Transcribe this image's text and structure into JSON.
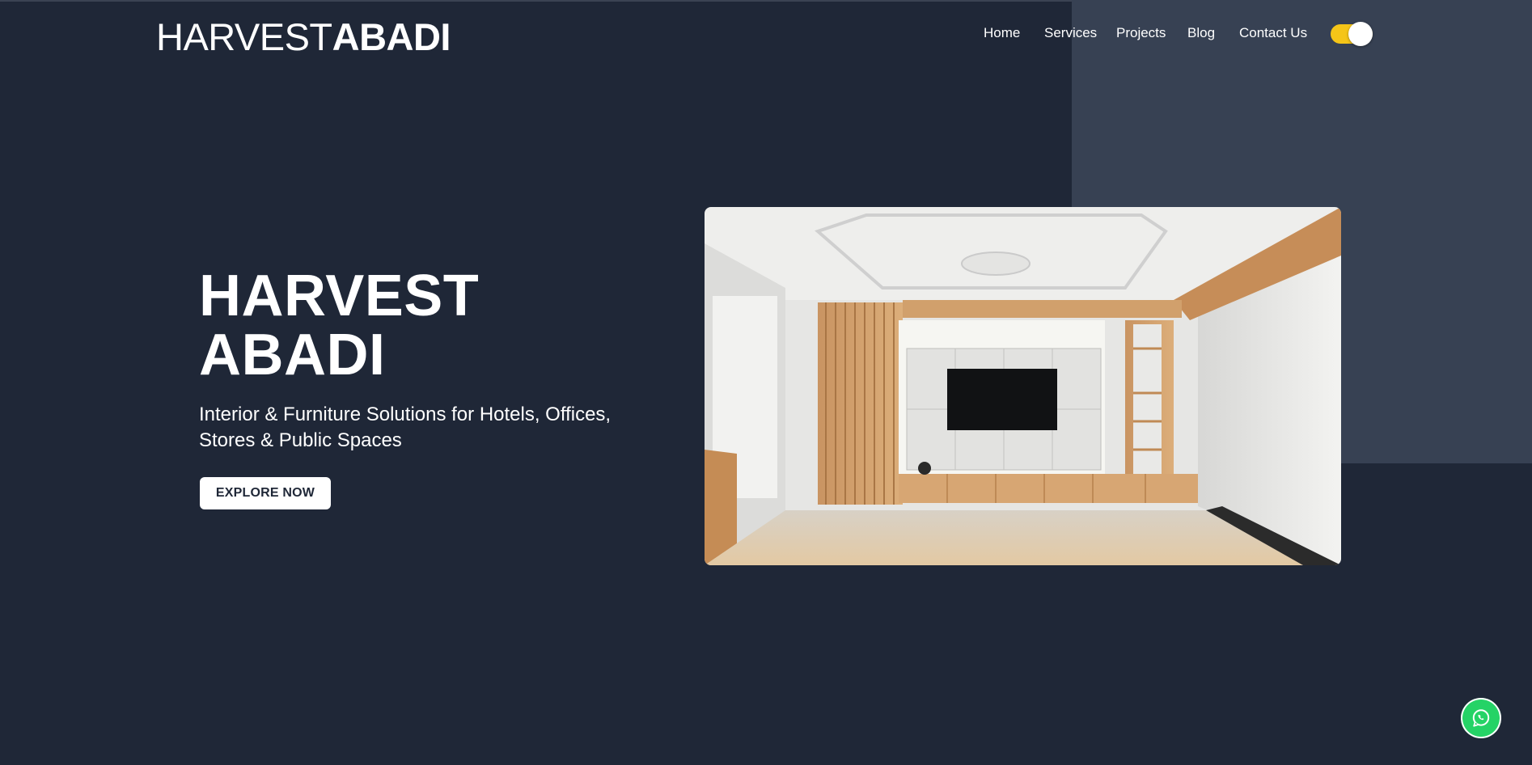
{
  "brand": {
    "name_light": "HARVEST",
    "name_bold": "ABADI"
  },
  "nav": {
    "items": [
      {
        "label": "Home"
      },
      {
        "label": "Services"
      },
      {
        "label": "Projects"
      },
      {
        "label": "Blog"
      },
      {
        "label": "Contact Us"
      }
    ]
  },
  "theme_toggle": {
    "state": "on",
    "color": "#f5c518"
  },
  "hero": {
    "title_line1": "HARVEST",
    "title_line2": "ABADI",
    "subtitle": "Interior & Furniture Solutions for Hotels, Offices, Stores & Public Spaces",
    "cta_label": "EXPLORE NOW",
    "image": "living-room-tv-wall-interior"
  },
  "whatsapp": {
    "icon": "whatsapp-icon",
    "color": "#25d366"
  },
  "colors": {
    "background": "#1f2737",
    "accent_panel": "#374153",
    "text": "#ffffff"
  }
}
